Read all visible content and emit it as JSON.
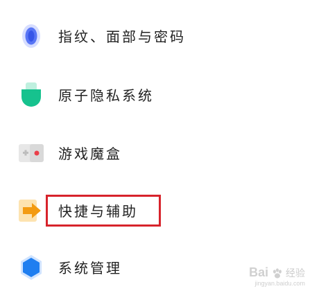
{
  "settings": {
    "items": [
      {
        "label": "指纹、面部与密码",
        "icon": "fingerprint-icon",
        "color": "#4a6cf7"
      },
      {
        "label": "原子隐私系统",
        "icon": "privacy-shield-icon",
        "color": "#14c08a"
      },
      {
        "label": "游戏魔盒",
        "icon": "game-box-icon",
        "color": "#e8414b"
      },
      {
        "label": "快捷与辅助",
        "icon": "shortcut-arrow-icon",
        "color": "#f6a21c"
      },
      {
        "label": "系统管理",
        "icon": "system-hexagon-icon",
        "color": "#1f7ef0"
      }
    ]
  },
  "highlight": {
    "color": "#d7232b"
  },
  "watermark": {
    "brand": "Bai",
    "brand_suffix": "经验",
    "url": "jingyan.baidu.com"
  }
}
